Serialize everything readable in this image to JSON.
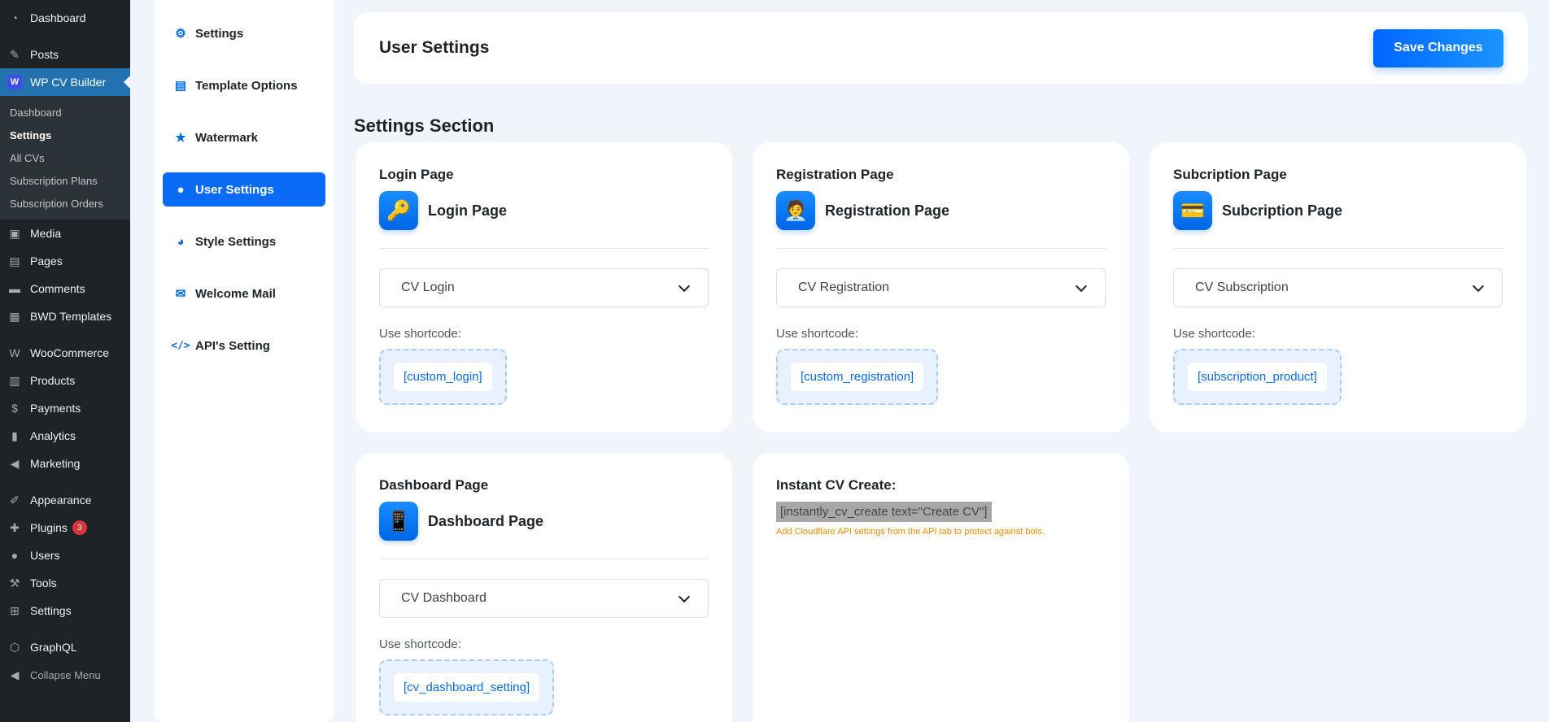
{
  "wp_menu": {
    "items_top": [
      {
        "label": "Dashboard",
        "icon": "dashboard-icon"
      },
      {
        "label": "Posts",
        "icon": "pin-icon"
      }
    ],
    "current": {
      "label": "WP CV Builder",
      "icon": "wpcv-icon"
    },
    "submenu": [
      "Dashboard",
      "Settings",
      "All CVs",
      "Subscription Plans",
      "Subscription Orders"
    ],
    "items_mid": [
      {
        "label": "Media",
        "icon": "media-icon"
      },
      {
        "label": "Pages",
        "icon": "pages-icon"
      },
      {
        "label": "Comments",
        "icon": "comments-icon"
      },
      {
        "label": "BWD Templates",
        "icon": "templates-icon"
      }
    ],
    "items_shop": [
      {
        "label": "WooCommerce",
        "icon": "woo-icon"
      },
      {
        "label": "Products",
        "icon": "products-icon"
      },
      {
        "label": "Payments",
        "icon": "payments-icon"
      },
      {
        "label": "Analytics",
        "icon": "analytics-icon"
      },
      {
        "label": "Marketing",
        "icon": "marketing-icon"
      }
    ],
    "items_admin": [
      {
        "label": "Appearance",
        "icon": "appearance-icon"
      },
      {
        "label": "Plugins",
        "icon": "plugins-icon",
        "badge": "3"
      },
      {
        "label": "Users",
        "icon": "users-icon"
      },
      {
        "label": "Tools",
        "icon": "tools-icon"
      },
      {
        "label": "Settings",
        "icon": "settings-icon"
      }
    ],
    "items_bottom": [
      {
        "label": "GraphQL",
        "icon": "graphql-icon"
      }
    ],
    "collapse": "Collapse Menu"
  },
  "plugin_nav": [
    {
      "label": "Settings",
      "icon": "gear-icon"
    },
    {
      "label": "Template Options",
      "icon": "file-icon"
    },
    {
      "label": "Watermark",
      "icon": "star-icon"
    },
    {
      "label": "User Settings",
      "icon": "user-icon",
      "active": true
    },
    {
      "label": "Style Settings",
      "icon": "palette-icon"
    },
    {
      "label": "Welcome Mail",
      "icon": "mail-icon"
    },
    {
      "label": "API's Setting",
      "icon": "code-icon"
    }
  ],
  "header": {
    "title": "User Settings",
    "save_label": "Save Changes"
  },
  "section_title": "Settings Section",
  "cards": {
    "login": {
      "title": "Login Page",
      "head": "Login Page",
      "icon": "key-icon",
      "select": "CV Login",
      "use_label": "Use shortcode:",
      "shortcode": "[custom_login]"
    },
    "registration": {
      "title": "Registration Page",
      "head": "Registration Page",
      "icon": "person-icon",
      "select": "CV Registration",
      "use_label": "Use shortcode:",
      "shortcode": "[custom_registration]"
    },
    "subscription": {
      "title": "Subcription Page",
      "head": "Subcription Page",
      "icon": "credit-card-icon",
      "select": "CV Subscription",
      "use_label": "Use shortcode:",
      "shortcode": "[subscription_product]"
    },
    "dashboard": {
      "title": "Dashboard Page",
      "head": "Dashboard Page",
      "icon": "phone-icon",
      "select": "CV Dashboard",
      "use_label": "Use shortcode:",
      "shortcode": "[cv_dashboard_setting]"
    }
  },
  "instant": {
    "title": "Instant CV Create:",
    "code": "[instantly_cv_create text=\"Create CV\"]",
    "note": "Add Cloudflare API settings from the API tab to protect against bots."
  }
}
